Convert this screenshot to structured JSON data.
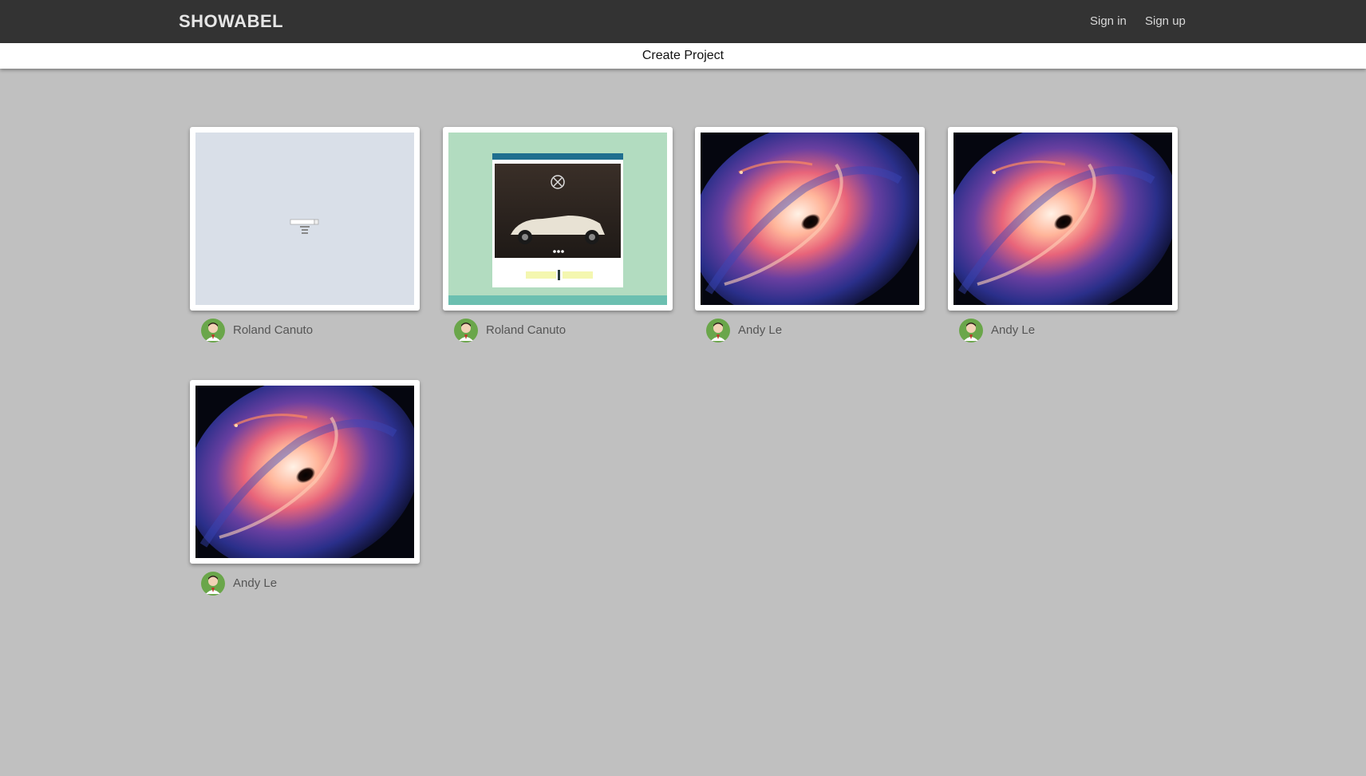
{
  "header": {
    "brand": "SHOWABEL",
    "sign_in": "Sign in",
    "sign_up": "Sign up"
  },
  "subnav": {
    "create_project": "Create Project"
  },
  "colors": {
    "topbar": "#333333",
    "page_bg": "#c0c0c0",
    "card_bg": "#ffffff"
  },
  "projects": [
    {
      "author": "Roland Canuto",
      "thumbnail": "blank-form-preview"
    },
    {
      "author": "Roland Canuto",
      "thumbnail": "classic-car-website-preview"
    },
    {
      "author": "Andy Le",
      "thumbnail": "black-hole-image"
    },
    {
      "author": "Andy Le",
      "thumbnail": "black-hole-image"
    },
    {
      "author": "Andy Le",
      "thumbnail": "black-hole-image"
    }
  ]
}
